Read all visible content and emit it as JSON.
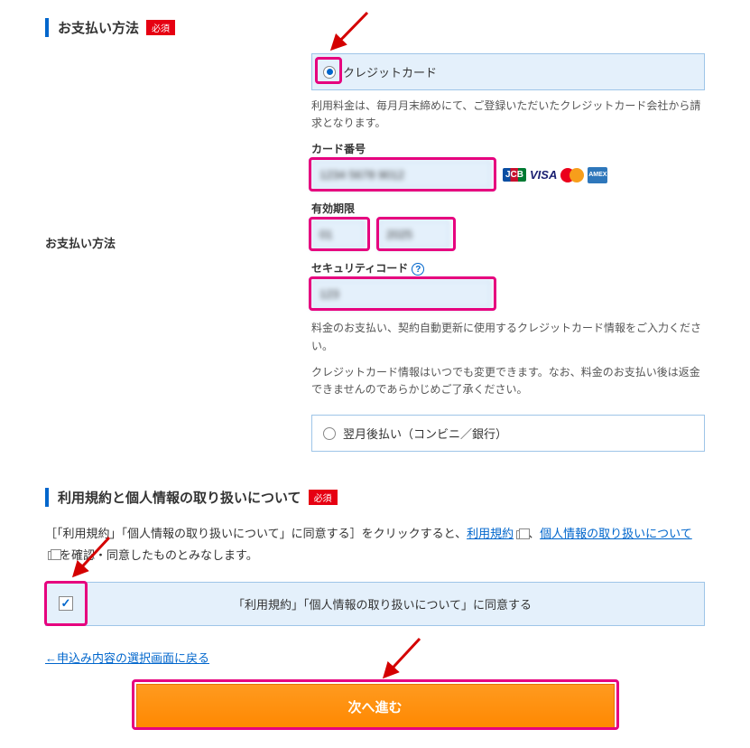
{
  "payment": {
    "section_title": "お支払い方法",
    "required_badge": "必須",
    "row_label": "お支払い方法",
    "credit_card": {
      "label": "クレジットカード",
      "note": "利用料金は、毎月月末締めにて、ご登録いただいたクレジットカード会社から請求となります。",
      "card_number_label": "カード番号",
      "card_number_value": "1234 5678 9012",
      "expiry_label": "有効期限",
      "expiry_month": "01",
      "expiry_year": "2025",
      "security_label": "セキュリティコード",
      "security_value": "123",
      "footer_note1": "料金のお支払い、契約自動更新に使用するクレジットカード情報をご入力ください。",
      "footer_note2": "クレジットカード情報はいつでも変更できます。なお、料金のお支払い後は返金できませんのであらかじめご了承ください。"
    },
    "later_pay": {
      "label": "翌月後払い（コンビニ／銀行）"
    }
  },
  "terms": {
    "section_title": "利用規約と個人情報の取り扱いについて",
    "required_badge": "必須",
    "text_prefix": "［「利用規約」「個人情報の取り扱いについて」に同意する］をクリックすると、",
    "link1": "利用規約",
    "text_mid": "、",
    "link2": "個人情報の取り扱いについて",
    "text_suffix": "を確認・同意したものとみなします。",
    "consent_label": "「利用規約」「個人情報の取り扱いについて」に同意する"
  },
  "back_link": "←申込み内容の選択画面に戻る",
  "submit_label": "次へ進む",
  "help_q": "?"
}
